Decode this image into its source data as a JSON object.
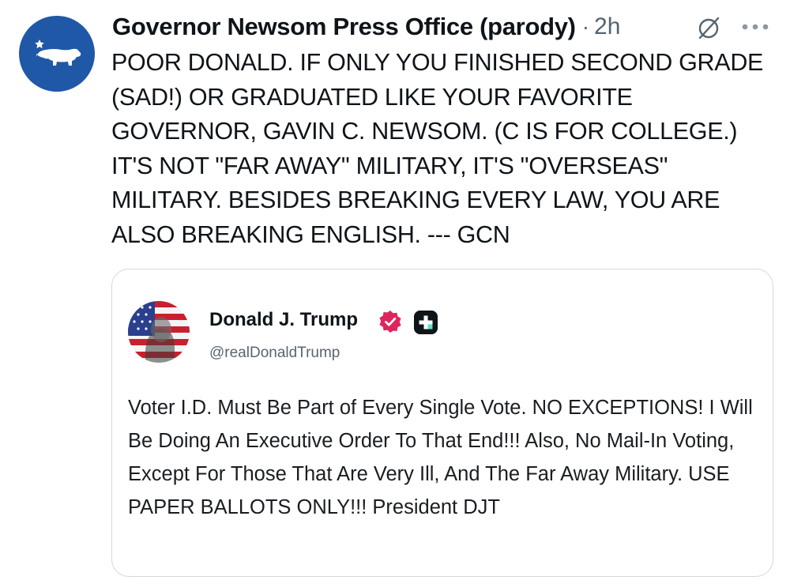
{
  "post": {
    "author_name": "Governor Newsom Press Office (parody)",
    "separator": "·",
    "time": "2h",
    "body": "POOR DONALD. IF ONLY YOU FINISHED SECOND GRADE (SAD!) OR GRADUATED LIKE YOUR FAVORITE GOVERNOR, GAVIN C. NEWSOM. (C IS FOR COLLEGE.) IT'S NOT \"FAR AWAY\" MILITARY, IT'S \"OVERSEAS\" MILITARY. BESIDES BREAKING EVERY LAW, YOU ARE ALSO BREAKING ENGLISH. --- GCN",
    "avatar_icon": "california-bear-icon",
    "avatar_color": "#1f58a6"
  },
  "icons": {
    "mute": "muted-circle-slash-icon",
    "more": "more-dots-icon"
  },
  "quote": {
    "author_name": "Donald J. Trump",
    "handle": "@realDonaldTrump",
    "verified_icon": "verified-badge-icon",
    "verified_color": "#e0245e",
    "platform_icon": "plus-square-icon",
    "body": "Voter I.D. Must Be Part of Every Single Vote. NO EXCEPTIONS! I Will Be Doing An Executive Order To That End!!! Also, No Mail-In Voting, Except For Those That Are Very Ill, And The Far Away Military. USE PAPER BALLOTS ONLY!!! President DJT"
  }
}
